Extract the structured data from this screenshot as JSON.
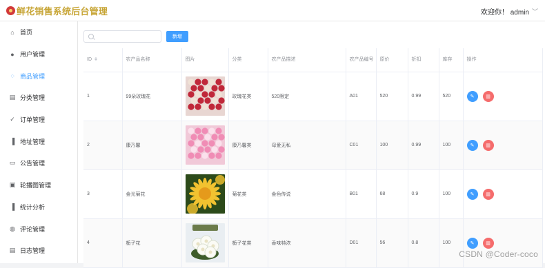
{
  "header": {
    "brand": "鲜花销售系统后台管理",
    "user": "欢迎你！ admin",
    "chevron": "﹀"
  },
  "sidebar": {
    "items": [
      {
        "label": "首页",
        "icon": "home-icon",
        "glyph": "⌂"
      },
      {
        "label": "用户管理",
        "icon": "user-icon",
        "glyph": "●"
      },
      {
        "label": "商品管理",
        "icon": "goods-icon",
        "glyph": "◌"
      },
      {
        "label": "分类管理",
        "icon": "category-icon",
        "glyph": "▤"
      },
      {
        "label": "订单管理",
        "icon": "order-icon",
        "glyph": "✓"
      },
      {
        "label": "地址管理",
        "icon": "address-icon",
        "glyph": "▐"
      },
      {
        "label": "公告管理",
        "icon": "notice-icon",
        "glyph": "▭"
      },
      {
        "label": "轮播图管理",
        "icon": "carousel-icon",
        "glyph": "▣"
      },
      {
        "label": "统计分析",
        "icon": "stats-icon",
        "glyph": "▐"
      },
      {
        "label": "评论管理",
        "icon": "comment-icon",
        "glyph": "◍"
      },
      {
        "label": "日志管理",
        "icon": "log-icon",
        "glyph": "▤"
      }
    ],
    "active_index": 2,
    "active_color": "#409eff"
  },
  "toolbar": {
    "search_placeholder": "",
    "add_label": "新增"
  },
  "table": {
    "columns": [
      "ID",
      "农产品名称",
      "图片",
      "分类",
      "农产品描述",
      "农产品编号",
      "原价",
      "折扣",
      "库存",
      "操作"
    ],
    "rows": [
      {
        "id": "1",
        "name": "99朵玫瑰花",
        "category": "玫瑰花类",
        "desc": "520限定",
        "code": "A01",
        "price": "520",
        "discount": "0.99",
        "stock": "520",
        "image": "red-roses"
      },
      {
        "id": "2",
        "name": "康乃馨",
        "category": "康乃馨类",
        "desc": "母爱无私",
        "code": "C01",
        "price": "100",
        "discount": "0.99",
        "stock": "100",
        "image": "pink-carnations"
      },
      {
        "id": "3",
        "name": "金光菊花",
        "category": "菊花类",
        "desc": "金色传说",
        "code": "B01",
        "price": "68",
        "discount": "0.9",
        "stock": "100",
        "image": "yellow-chrysanthemum"
      },
      {
        "id": "4",
        "name": "栀子花",
        "category": "栀子花类",
        "desc": "香味特浓",
        "code": "D01",
        "price": "56",
        "discount": "0.8",
        "stock": "100",
        "image": "white-gardenia"
      }
    ],
    "edit_glyph": "✎",
    "delete_glyph": "▥"
  },
  "watermark": "CSDN @Coder-coco",
  "colors": {
    "primary": "#409eff",
    "danger": "#f56c6c",
    "brand": "#c7a536"
  }
}
